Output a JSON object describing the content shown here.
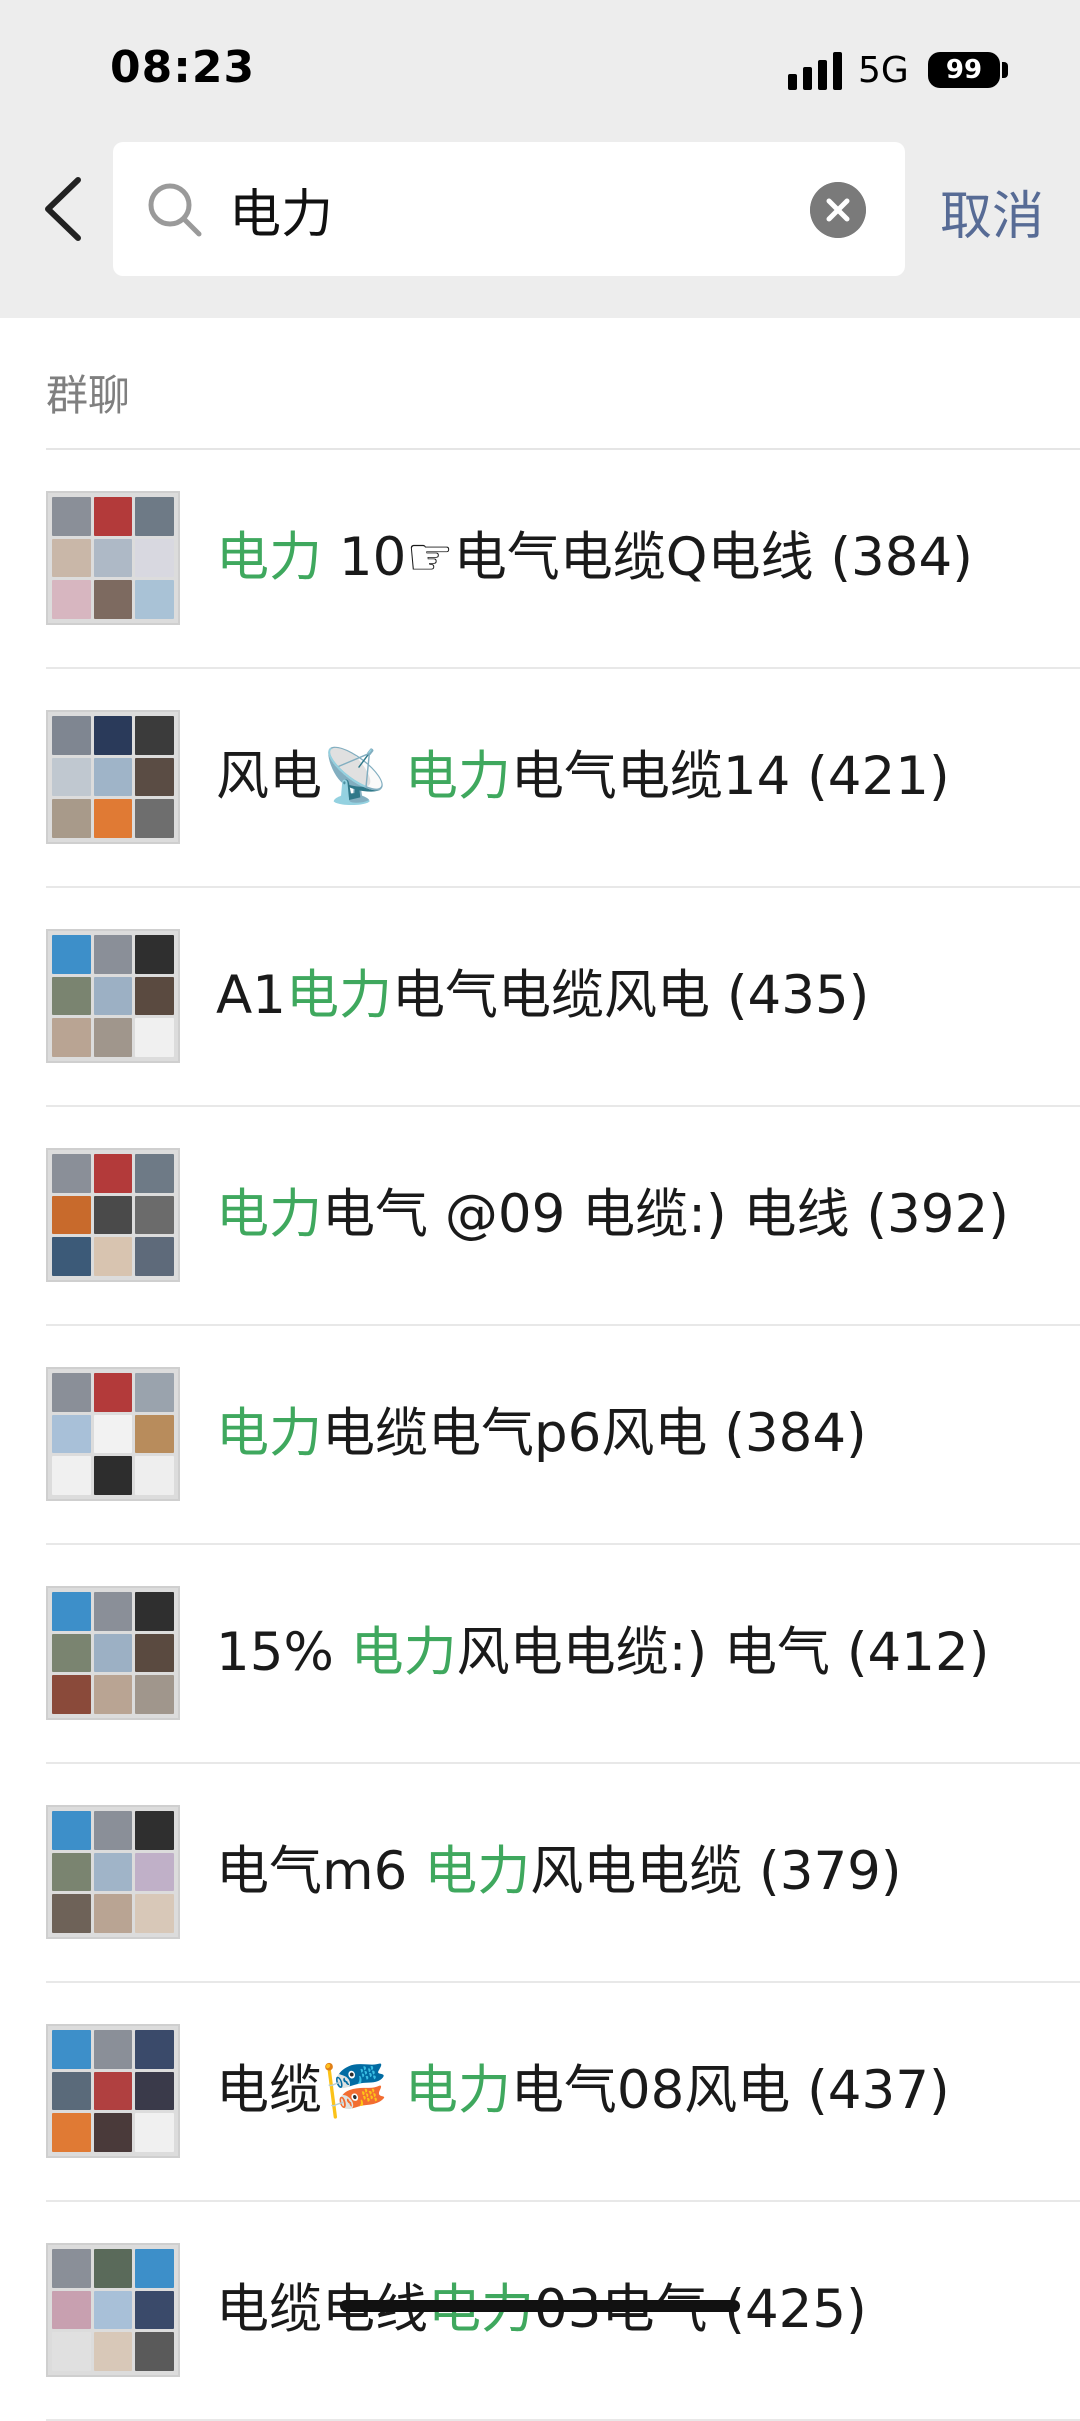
{
  "status_bar": {
    "time": "08:23",
    "network": "5G",
    "battery": "99",
    "signal_icon": "signal-bars-icon"
  },
  "search": {
    "query": "电力",
    "cancel_label": "取消",
    "back_icon": "chevron-left-icon",
    "search_icon": "magnifier-icon",
    "clear_icon": "clear-x-icon"
  },
  "section": {
    "title": "群聊"
  },
  "colors": {
    "highlight": "#3fa85e",
    "link": "#576b95",
    "header_bg": "#ededed"
  },
  "results": [
    {
      "pre": "",
      "hl": "电力",
      "post": " 10☞电气电缆Q电线 (384)",
      "avatar_icon": "group-avatar-grid-icon"
    },
    {
      "pre": "风电📡 ",
      "hl": "电力",
      "post": "电气电缆14 (421)",
      "avatar_icon": "group-avatar-grid-icon"
    },
    {
      "pre": "A1",
      "hl": "电力",
      "post": "电气电缆风电 (435)",
      "avatar_icon": "group-avatar-grid-icon"
    },
    {
      "pre": "",
      "hl": "电力",
      "post": "电气 @09 电缆:) 电线 (392)",
      "avatar_icon": "group-avatar-grid-icon"
    },
    {
      "pre": "",
      "hl": "电力",
      "post": "电缆电气p6风电 (384)",
      "avatar_icon": "group-avatar-grid-icon"
    },
    {
      "pre": "15% ",
      "hl": "电力",
      "post": "风电电缆:) 电气 (412)",
      "avatar_icon": "group-avatar-grid-icon"
    },
    {
      "pre": "电气m6 ",
      "hl": "电力",
      "post": "风电电缆 (379)",
      "avatar_icon": "group-avatar-grid-icon"
    },
    {
      "pre": "电缆🎏 ",
      "hl": "电力",
      "post": "电气08风电 (437)",
      "avatar_icon": "group-avatar-grid-icon"
    },
    {
      "pre": "电缆电线",
      "hl": "电力",
      "post": "03电气 (425)",
      "avatar_icon": "group-avatar-grid-icon"
    }
  ]
}
